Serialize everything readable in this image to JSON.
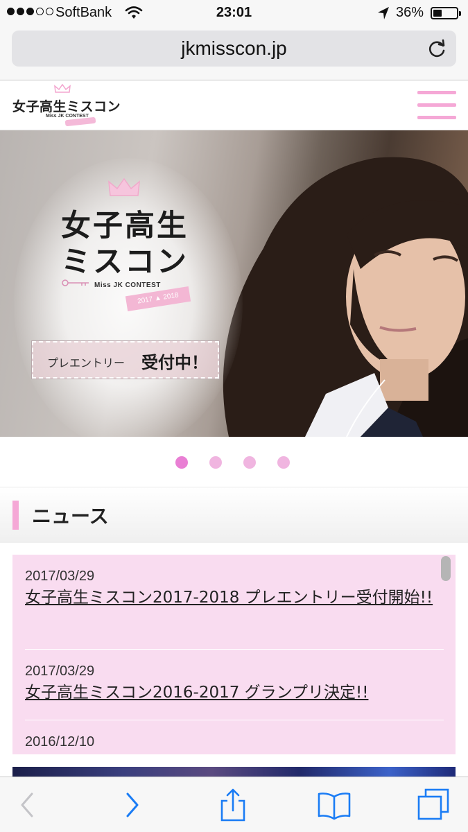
{
  "status_bar": {
    "carrier": "SoftBank",
    "time": "23:01",
    "battery_percent": "36%",
    "battery_level": 0.36,
    "signal_bars": 3,
    "signal_total": 5
  },
  "browser": {
    "url": "jkmisscon.jp"
  },
  "header": {
    "logo_text": "女子高生ミスコン",
    "logo_sub": "Miss JK CONTEST"
  },
  "hero": {
    "title_line1": "女子高生",
    "title_line2": "ミスコン",
    "subtitle": "Miss JK CONTEST",
    "ribbon": "2017 ▲ 2018",
    "entry_small": "プレエントリー",
    "entry_big": "受付中！"
  },
  "carousel": {
    "total": 4,
    "active_index": 0
  },
  "news": {
    "heading": "ニュース",
    "items": [
      {
        "date": "2017/03/29",
        "title": "女子高生ミスコン2017-2018 プレエントリー受付開始!!"
      },
      {
        "date": "2017/03/29",
        "title": "女子高生ミスコン2016-2017 グランプリ決定!!"
      },
      {
        "date": "2016/12/10",
        "title": ""
      }
    ]
  },
  "colors": {
    "accent_pink": "#f5a8d6",
    "news_bg": "#f9dcf0",
    "dot_active": "#e97fd4",
    "dot_inactive": "#f0b5e0",
    "ios_blue": "#1a7cf5"
  },
  "icons": {
    "status": [
      "wifi-icon",
      "location-arrow-icon",
      "battery-icon"
    ],
    "toolbar": [
      "back-icon",
      "forward-icon",
      "share-icon",
      "bookmarks-icon",
      "tabs-icon"
    ]
  }
}
